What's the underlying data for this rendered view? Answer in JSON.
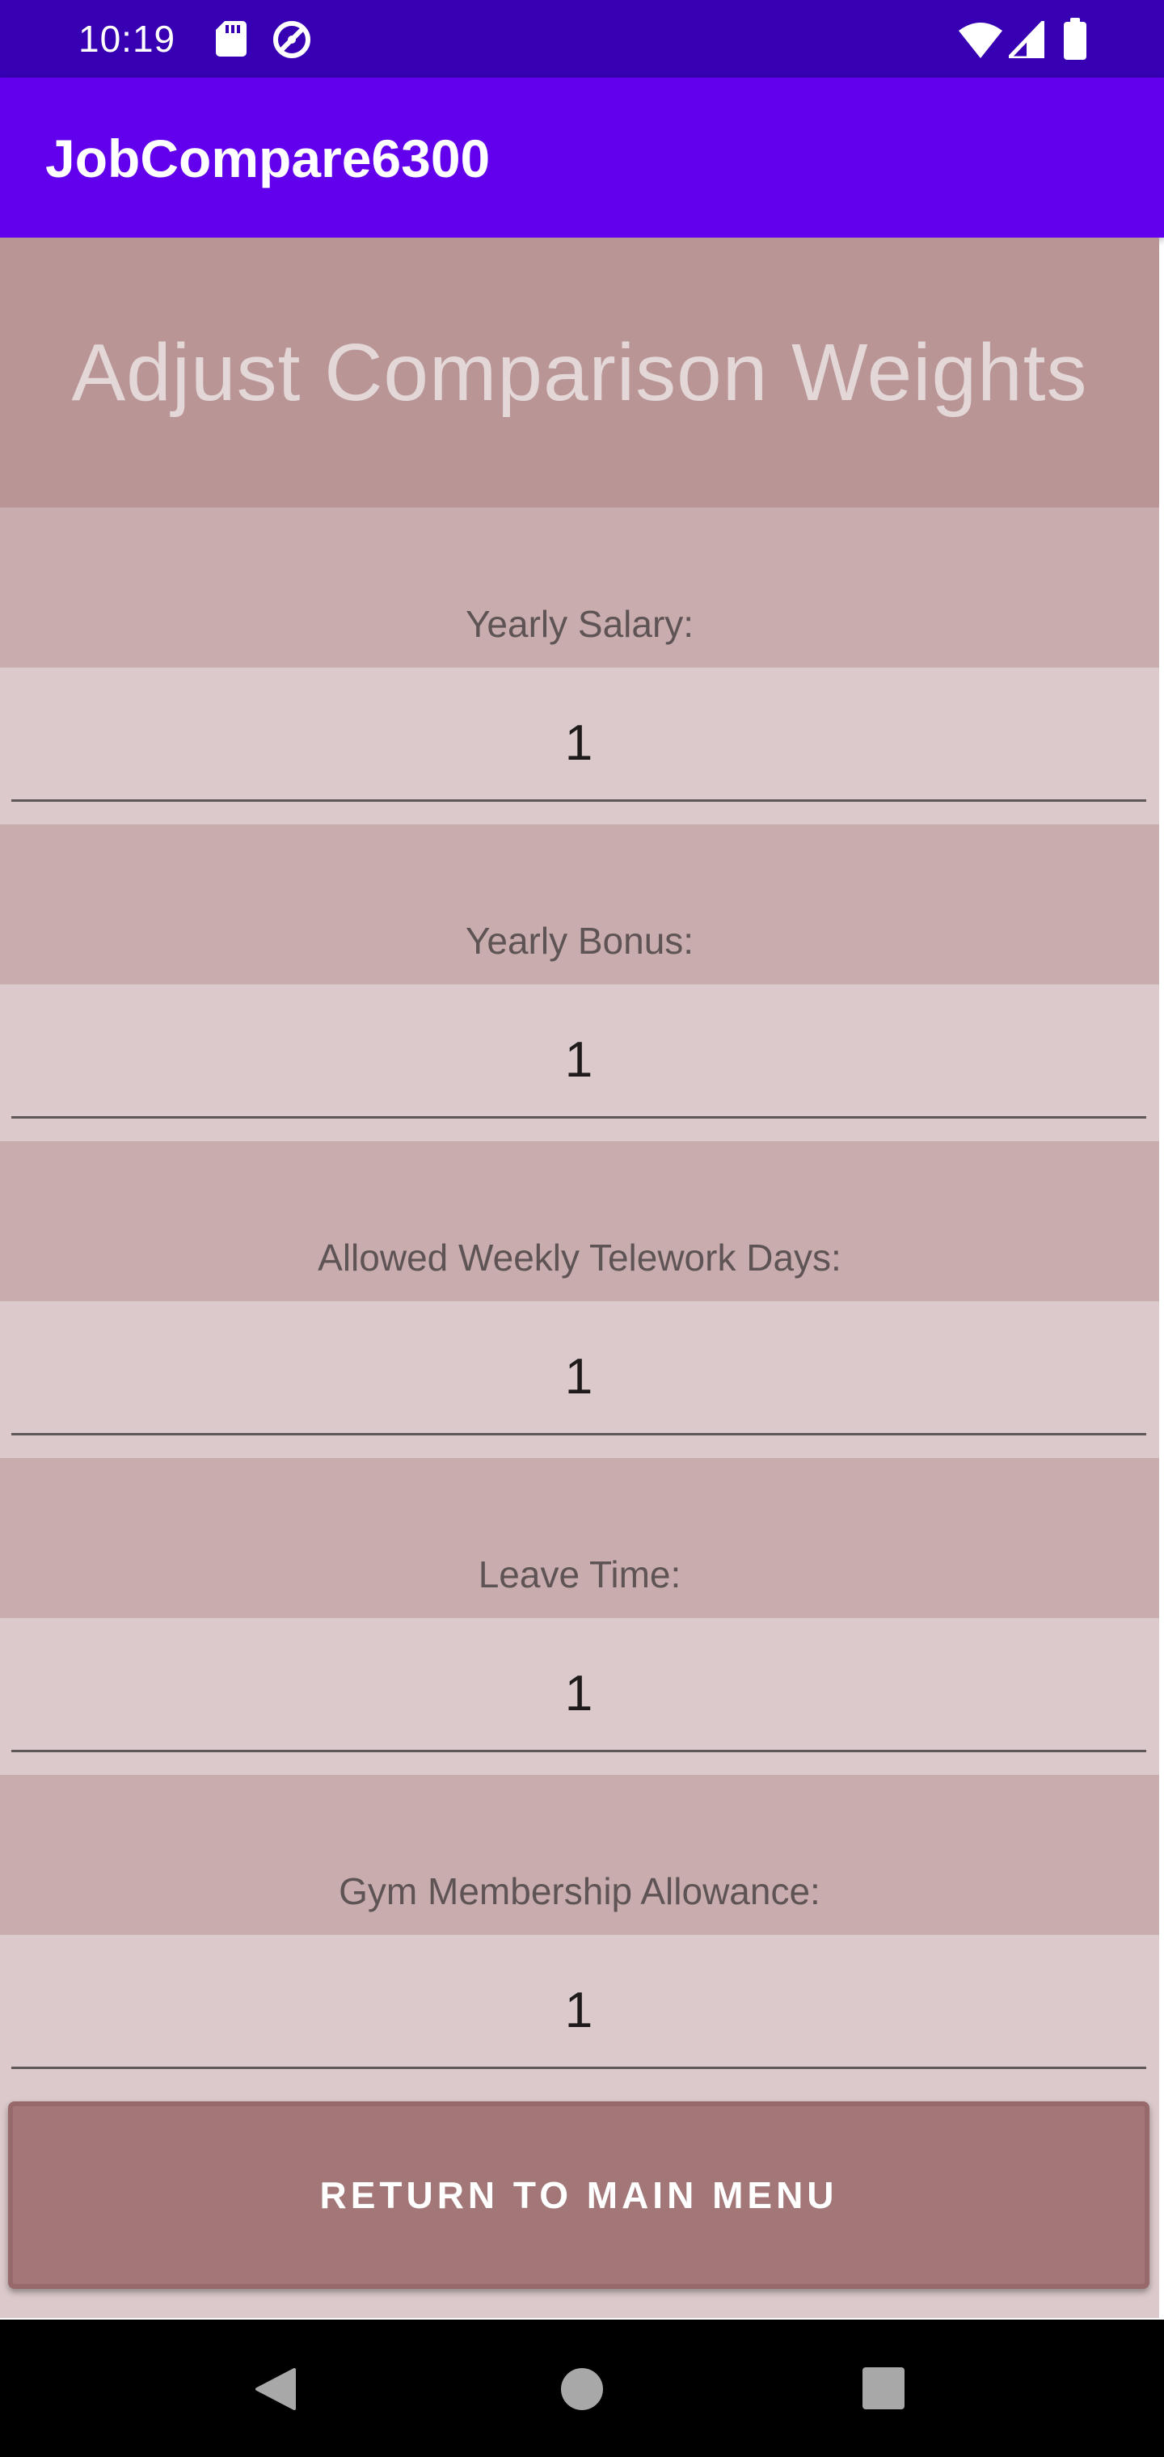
{
  "status_bar": {
    "time": "10:19",
    "icons_left": [
      "sd-card-icon",
      "do-not-disturb-icon"
    ],
    "icons_right": [
      "wifi-icon",
      "cell-signal-icon",
      "battery-icon"
    ]
  },
  "app_bar": {
    "title": "JobCompare6300"
  },
  "page": {
    "heading": "Adjust Comparison Weights"
  },
  "weights": [
    {
      "label": "Yearly Salary:",
      "value": "1"
    },
    {
      "label": "Yearly Bonus:",
      "value": "1"
    },
    {
      "label": "Allowed Weekly Telework Days:",
      "value": "1"
    },
    {
      "label": "Leave Time:",
      "value": "1"
    },
    {
      "label": "Gym Membership Allowance:",
      "value": "1"
    }
  ],
  "actions": {
    "return_label": "RETURN TO MAIN MENU"
  },
  "nav_bar": {
    "icons": [
      "back-icon",
      "home-icon",
      "recents-icon"
    ]
  },
  "colors": {
    "status_bar": "#3700b3",
    "app_bar": "#6200ee",
    "heading_background": "#b99595",
    "label_background": "#c9acad",
    "field_background": "#dbc9cb",
    "button": "#a37778"
  }
}
